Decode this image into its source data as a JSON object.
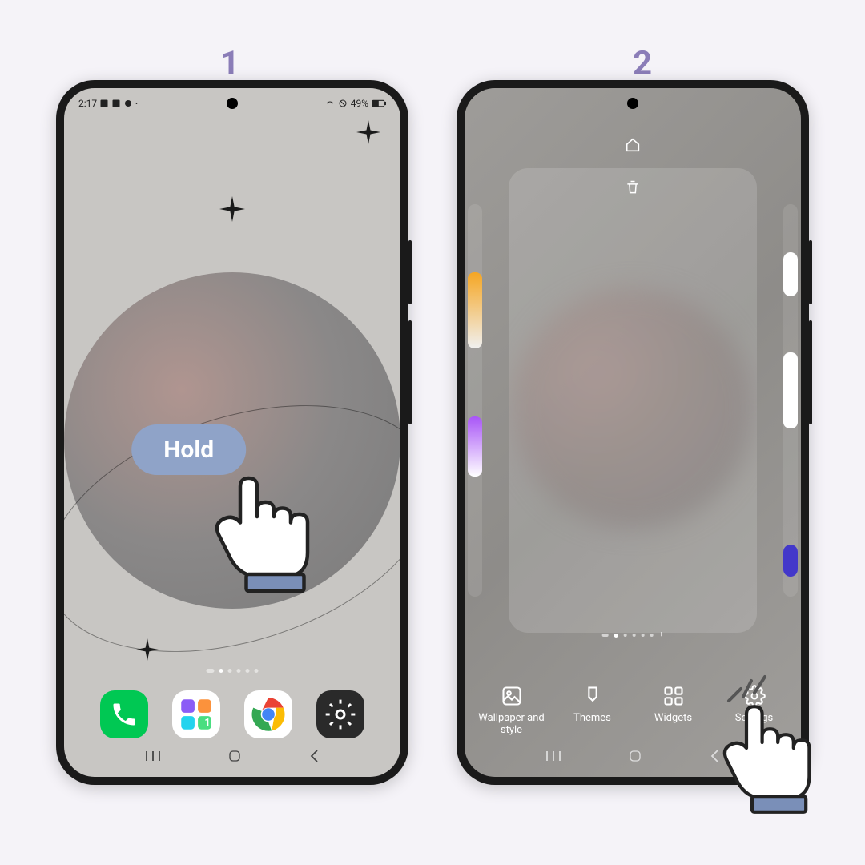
{
  "steps": {
    "one": "1",
    "two": "2"
  },
  "phone1": {
    "status": {
      "time": "2:17",
      "battery": "49%"
    },
    "hold_label": "Hold",
    "page_indicator_active": 1,
    "page_indicator_count": 6
  },
  "phone2": {
    "edit_menu": {
      "wallpaper": "Wallpaper and style",
      "themes": "Themes",
      "widgets": "Widgets",
      "settings": "Settings"
    },
    "page_indicator_active": 1,
    "page_indicator_count": 6
  }
}
